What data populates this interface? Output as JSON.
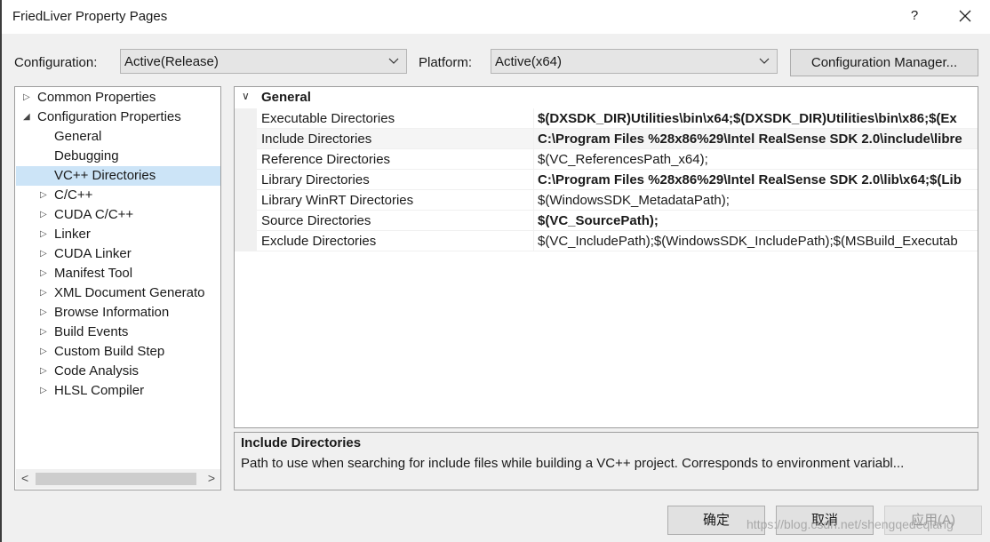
{
  "window": {
    "title": "FriedLiver Property Pages",
    "help_label": "?"
  },
  "config": {
    "configuration_label": "Configuration:",
    "configuration_value": "Active(Release)",
    "platform_label": "Platform:",
    "platform_value": "Active(x64)",
    "manager_button": "Configuration Manager..."
  },
  "tree": {
    "items": [
      {
        "label": "Common Properties",
        "arrow": "▷"
      },
      {
        "label": "Configuration Properties",
        "arrow": "◢"
      },
      {
        "label": "General",
        "arrow": ""
      },
      {
        "label": "Debugging",
        "arrow": ""
      },
      {
        "label": "VC++ Directories",
        "arrow": ""
      },
      {
        "label": "C/C++",
        "arrow": "▷"
      },
      {
        "label": "CUDA C/C++",
        "arrow": "▷"
      },
      {
        "label": "Linker",
        "arrow": "▷"
      },
      {
        "label": "CUDA Linker",
        "arrow": "▷"
      },
      {
        "label": "Manifest Tool",
        "arrow": "▷"
      },
      {
        "label": "XML Document Generato",
        "arrow": "▷"
      },
      {
        "label": "Browse Information",
        "arrow": "▷"
      },
      {
        "label": "Build Events",
        "arrow": "▷"
      },
      {
        "label": "Custom Build Step",
        "arrow": "▷"
      },
      {
        "label": "Code Analysis",
        "arrow": "▷"
      },
      {
        "label": "HLSL Compiler",
        "arrow": "▷"
      }
    ],
    "selected_label": "VC++ Directories"
  },
  "grid": {
    "category": "General",
    "rows": [
      {
        "name": "Executable Directories",
        "value": "$(DXSDK_DIR)Utilities\\bin\\x64;$(DXSDK_DIR)Utilities\\bin\\x86;$(Ex",
        "bold": true
      },
      {
        "name": "Include Directories",
        "value": "C:\\Program Files %28x86%29\\Intel RealSense SDK 2.0\\include\\libre",
        "bold": true
      },
      {
        "name": "Reference Directories",
        "value": "$(VC_ReferencesPath_x64);",
        "bold": false
      },
      {
        "name": "Library Directories",
        "value": "C:\\Program Files %28x86%29\\Intel RealSense SDK 2.0\\lib\\x64;$(Lib",
        "bold": true
      },
      {
        "name": "Library WinRT Directories",
        "value": "$(WindowsSDK_MetadataPath);",
        "bold": false
      },
      {
        "name": "Source Directories",
        "value": "$(VC_SourcePath);",
        "bold": true
      },
      {
        "name": "Exclude Directories",
        "value": "$(VC_IncludePath);$(WindowsSDK_IncludePath);$(MSBuild_Executab",
        "bold": false
      }
    ]
  },
  "description": {
    "title": "Include Directories",
    "text": "Path to use when searching for include files while building a VC++ project.  Corresponds to environment variabl..."
  },
  "buttons": {
    "ok": "确定",
    "cancel": "取消",
    "apply": "应用(A)"
  },
  "watermark": "https://blog.csdn.net/shengqedeqiang"
}
